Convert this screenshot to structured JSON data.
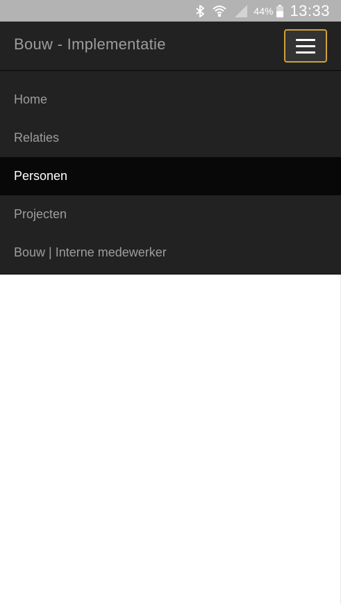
{
  "status_bar": {
    "icons": [
      "bluetooth-icon",
      "wifi-icon",
      "signal-icon",
      "battery-icon"
    ],
    "battery_percent": "44%",
    "time": "13:33"
  },
  "navbar": {
    "brand": "Bouw - Implementatie",
    "toggle_icon": "hamburger-menu-icon",
    "toggle_border_color": "#d1a23a",
    "background_color": "#222222",
    "active_background_color": "#080808"
  },
  "menu": {
    "items": [
      {
        "label": "Home",
        "active": false
      },
      {
        "label": "Relaties",
        "active": false
      },
      {
        "label": "Personen",
        "active": true
      },
      {
        "label": "Projecten",
        "active": false
      },
      {
        "label": "Bouw | Interne medewerker",
        "active": false
      }
    ]
  }
}
